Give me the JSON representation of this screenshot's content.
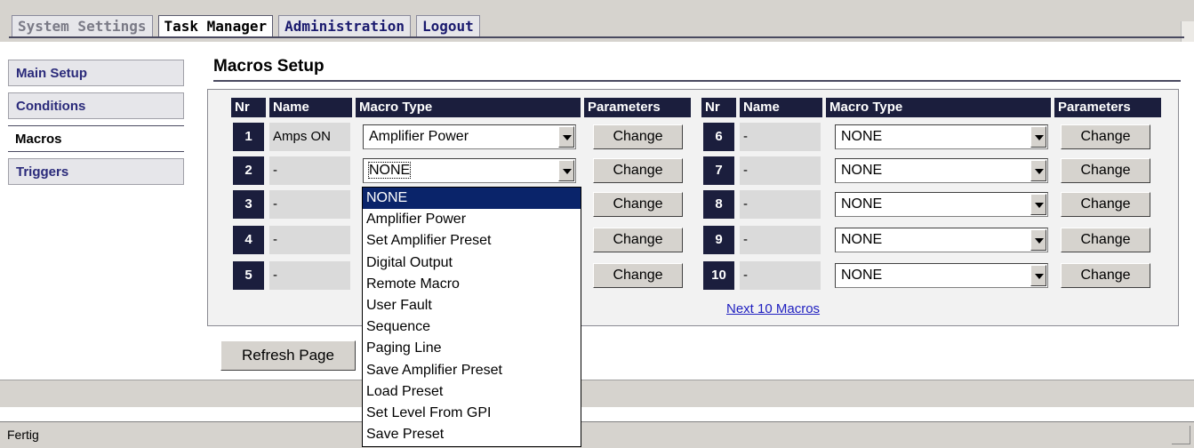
{
  "tabs": [
    "System Settings",
    "Task Manager",
    "Administration",
    "Logout"
  ],
  "sidebar": [
    "Main Setup",
    "Conditions",
    "Macros",
    "Triggers"
  ],
  "page_title": "Macros Setup",
  "headers": {
    "nr": "Nr",
    "name": "Name",
    "type": "Macro Type",
    "params": "Parameters"
  },
  "macros": [
    {
      "nr": "1",
      "name": "Amps ON",
      "type": "Amplifier Power",
      "action": "Change"
    },
    {
      "nr": "2",
      "name": "-",
      "type": "NONE",
      "action": "Change"
    },
    {
      "nr": "3",
      "name": "-",
      "type": "",
      "action": "Change"
    },
    {
      "nr": "4",
      "name": "-",
      "type": "",
      "action": "Change"
    },
    {
      "nr": "5",
      "name": "-",
      "type": "",
      "action": "Change"
    },
    {
      "nr": "6",
      "name": "-",
      "type": "NONE",
      "action": "Change"
    },
    {
      "nr": "7",
      "name": "-",
      "type": "NONE",
      "action": "Change"
    },
    {
      "nr": "8",
      "name": "-",
      "type": "NONE",
      "action": "Change"
    },
    {
      "nr": "9",
      "name": "-",
      "type": "NONE",
      "action": "Change"
    },
    {
      "nr": "10",
      "name": "-",
      "type": "NONE",
      "action": "Change"
    }
  ],
  "next_link": "Next 10 Macros",
  "refresh_label": "Refresh Page",
  "status": "Fertig",
  "dropdown_options": [
    "NONE",
    "Amplifier Power",
    "Set Amplifier Preset",
    "Digital Output",
    "Remote Macro",
    "User Fault",
    "Sequence",
    "Paging Line",
    "Save Amplifier Preset",
    "Load Preset",
    "Set Level From GPI",
    "Save Preset"
  ]
}
